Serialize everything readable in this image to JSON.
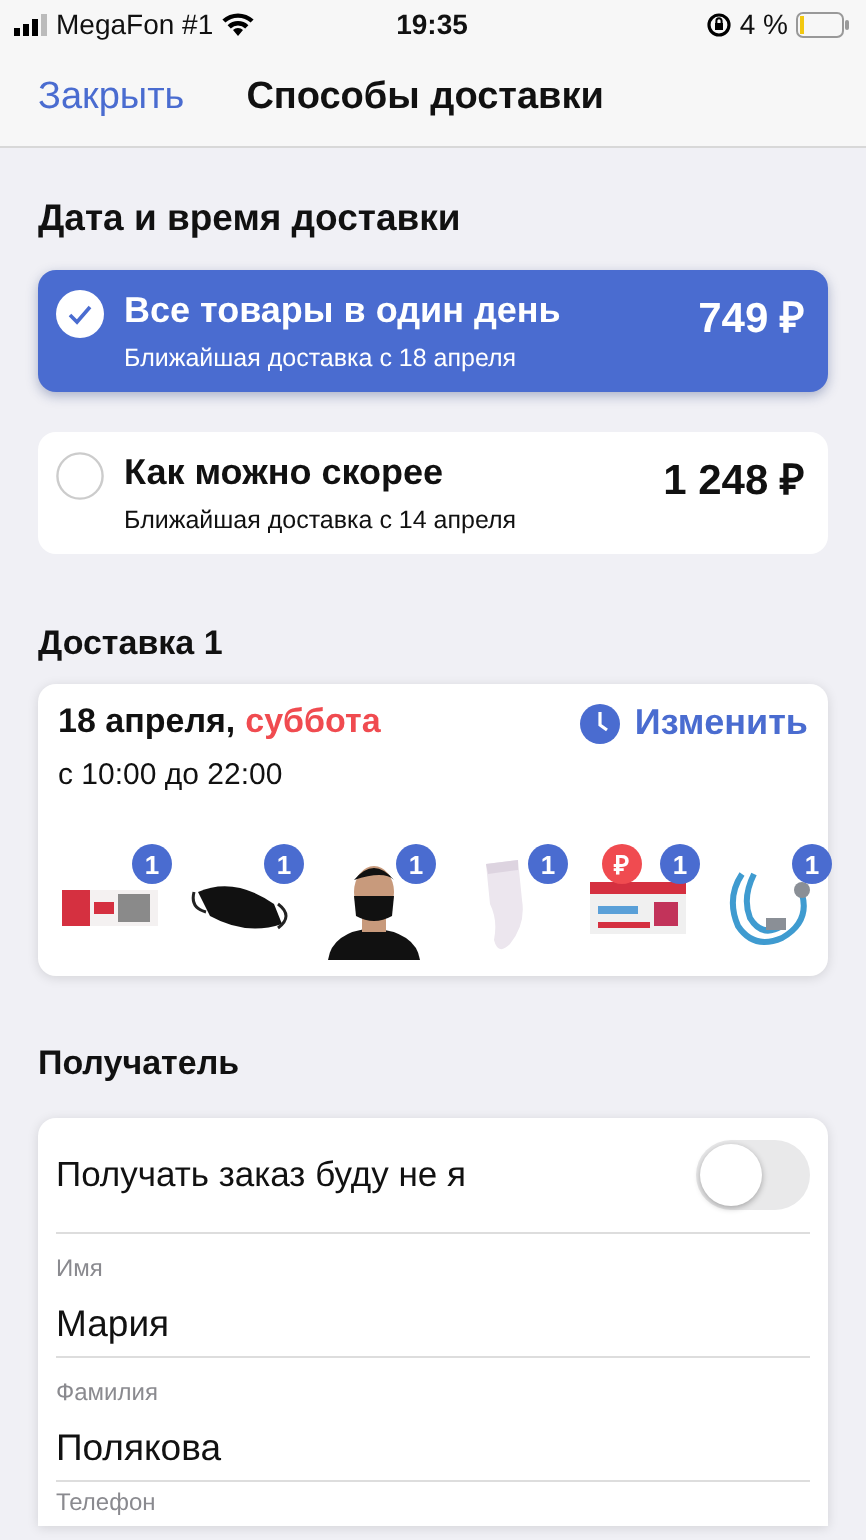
{
  "status_bar": {
    "carrier": "MegaFon #1",
    "time": "19:35",
    "battery": "4 %"
  },
  "nav": {
    "close": "Закрыть",
    "title": "Способы доставки"
  },
  "delivery_section": {
    "heading": "Дата и время доставки",
    "options": [
      {
        "title": "Все товары в один день",
        "subtitle": "Ближайшая доставка с 18 апреля",
        "price": "749 ₽",
        "selected": true
      },
      {
        "title": "Как можно скорее",
        "subtitle": "Ближайшая доставка с 14 апреля",
        "price": "1 248 ₽",
        "selected": false
      }
    ]
  },
  "shipment": {
    "heading": "Доставка 1",
    "date": "18 апреля,",
    "weekday": "суббота",
    "time": "с 10:00 до 22:00",
    "change": "Изменить",
    "items": [
      {
        "kind": "tube",
        "count": "1"
      },
      {
        "kind": "mask",
        "count": "1"
      },
      {
        "kind": "person",
        "count": "1"
      },
      {
        "kind": "sock",
        "count": "1"
      },
      {
        "kind": "box",
        "count": "1",
        "promo": "₽"
      },
      {
        "kind": "stethoscope",
        "count": "1"
      }
    ]
  },
  "recipient": {
    "heading": "Получатель",
    "toggle": {
      "label": "Получать заказ буду не я",
      "on": false
    },
    "fields": [
      {
        "label": "Имя",
        "value": "Мария"
      },
      {
        "label": "Фамилия",
        "value": "Полякова"
      },
      {
        "label": "Телефон"
      }
    ]
  }
}
